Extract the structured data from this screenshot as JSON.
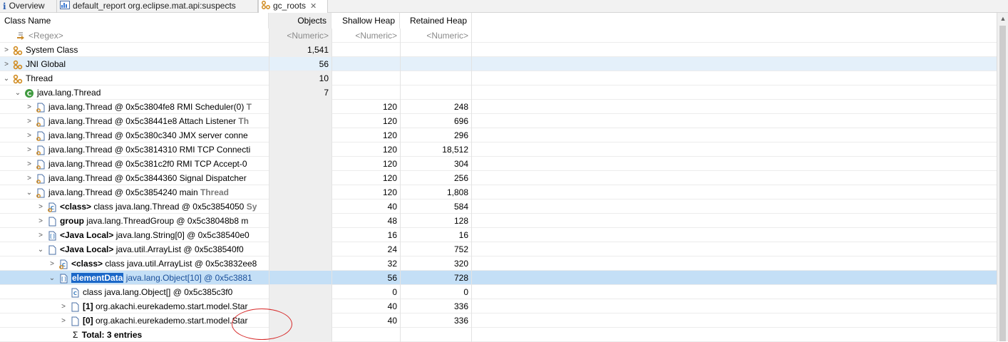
{
  "tabs": [
    {
      "label": "Overview",
      "icon": "info-icon"
    },
    {
      "label": "default_report  org.eclipse.mat.api:suspects",
      "icon": "report-icon"
    },
    {
      "label": "gc_roots",
      "icon": "gc-roots-icon",
      "active": true,
      "close": "✕"
    }
  ],
  "columns": {
    "name": "Class Name",
    "objects": "Objects",
    "shallow": "Shallow Heap",
    "retained": "Retained Heap"
  },
  "filters": {
    "name": "<Regex>",
    "objects": "<Numeric>",
    "shallow": "<Numeric>",
    "retained": "<Numeric>"
  },
  "rows": [
    {
      "label": "System Class",
      "objects": "1,541"
    },
    {
      "label": "JNI Global",
      "objects": "56"
    },
    {
      "label": "Thread",
      "objects": "10"
    },
    {
      "label": "java.lang.Thread",
      "objects": "7"
    },
    {
      "label": "java.lang.Thread @ 0x5c3804fe8  RMI Scheduler(0) ",
      "suffix": "T",
      "shallow": "120",
      "retained": "248"
    },
    {
      "label": "java.lang.Thread @ 0x5c38441e8  Attach Listener ",
      "suffix": "Th",
      "shallow": "120",
      "retained": "696"
    },
    {
      "label": "java.lang.Thread @ 0x5c380c340  JMX server conne",
      "shallow": "120",
      "retained": "296"
    },
    {
      "label": "java.lang.Thread @ 0x5c3814310  RMI TCP Connecti",
      "shallow": "120",
      "retained": "18,512"
    },
    {
      "label": "java.lang.Thread @ 0x5c381c2f0  RMI TCP Accept-0 ",
      "shallow": "120",
      "retained": "304"
    },
    {
      "label": "java.lang.Thread @ 0x5c3844360  Signal Dispatcher ",
      "shallow": "120",
      "retained": "256"
    },
    {
      "label": "java.lang.Thread @ 0x5c3854240  main ",
      "suffix": "Thread",
      "shallow": "120",
      "retained": "1,808"
    },
    {
      "prefix": "<class>",
      "label": " class java.lang.Thread @ 0x5c3854050 ",
      "suffix": "Sy",
      "shallow": "40",
      "retained": "584"
    },
    {
      "prefix": "group",
      "label": " java.lang.ThreadGroup @ 0x5c38048b8  m",
      "shallow": "48",
      "retained": "128"
    },
    {
      "prefix": "<Java Local>",
      "label": " java.lang.String[0] @ 0x5c38540e0",
      "shallow": "16",
      "retained": "16"
    },
    {
      "prefix": "<Java Local>",
      "label": " java.util.ArrayList @ 0x5c38540f0",
      "shallow": "24",
      "retained": "752"
    },
    {
      "prefix": "<class>",
      "label": " class java.util.ArrayList @ 0x5c3832ee8",
      "shallow": "32",
      "retained": "320"
    },
    {
      "prefix": "elementData",
      "label": " java.lang.Object[10] @ 0x5c3881",
      "shallow": "56",
      "retained": "728"
    },
    {
      "label": "class java.lang.Object[] @ 0x5c385c3f0",
      "shallow": "0",
      "retained": "0"
    },
    {
      "prefix": "[1]",
      "label": " org.akachi.eurekademo.start.model.Star",
      "shallow": "40",
      "retained": "336"
    },
    {
      "prefix": "[0]",
      "label": " org.akachi.eurekademo.start.model.Star",
      "shallow": "40",
      "retained": "336"
    },
    {
      "prefix": "Σ",
      "label": " Total: 3 entries"
    }
  ],
  "colors": {
    "selection": "#c4dff6",
    "selection_light": "#e4f0fa",
    "highlight": "#1a67c8",
    "annotation": "#d72a2a"
  }
}
